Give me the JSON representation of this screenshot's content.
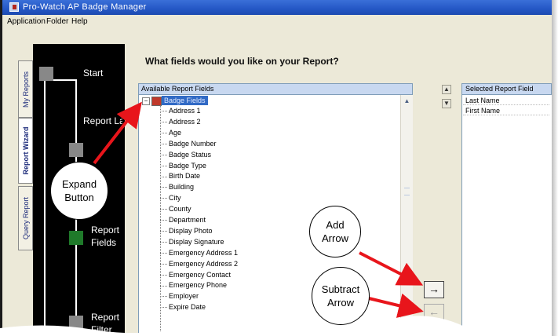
{
  "window": {
    "title": "Pro-Watch AP Badge Manager"
  },
  "menu": [
    "Application",
    "Folder",
    "Help"
  ],
  "side_tabs": [
    "My Reports",
    "Report Wizard",
    "Query Report"
  ],
  "wizard_steps": [
    {
      "label": "Start"
    },
    {
      "label": "Report Layout"
    },
    {
      "label": "Report Fields",
      "active": true
    },
    {
      "label": "Report Filter"
    }
  ],
  "main": {
    "question": "What fields would you like on your Report?",
    "available_header": "Available Report Fields",
    "root_node": "Badge Fields",
    "fields": [
      "Address 1",
      "Address 2",
      "Age",
      "Badge Number",
      "Badge Status",
      "Badge Type",
      "Birth Date",
      "Building",
      "City",
      "County",
      "Department",
      "Display Photo",
      "Display Signature",
      "Emergency Address 1",
      "Emergency Address 2",
      "Emergency Contact",
      "Emergency Phone",
      "Employer",
      "Expire Date"
    ],
    "selected_header": "Selected Report Field",
    "selected": [
      "Last Name",
      "First Name"
    ],
    "add_arrow": "→",
    "subtract_arrow": "←",
    "move_up": "▲",
    "move_down": "▼"
  },
  "callouts": {
    "expand": [
      "Expand",
      "Button"
    ],
    "add": [
      "Add",
      "Arrow"
    ],
    "subtract": [
      "Subtract",
      "Arrow"
    ]
  },
  "colors": {
    "annotation_arrow": "#e8151b",
    "title_bar": "#2457c5",
    "active_step": "#1f7a2a"
  }
}
